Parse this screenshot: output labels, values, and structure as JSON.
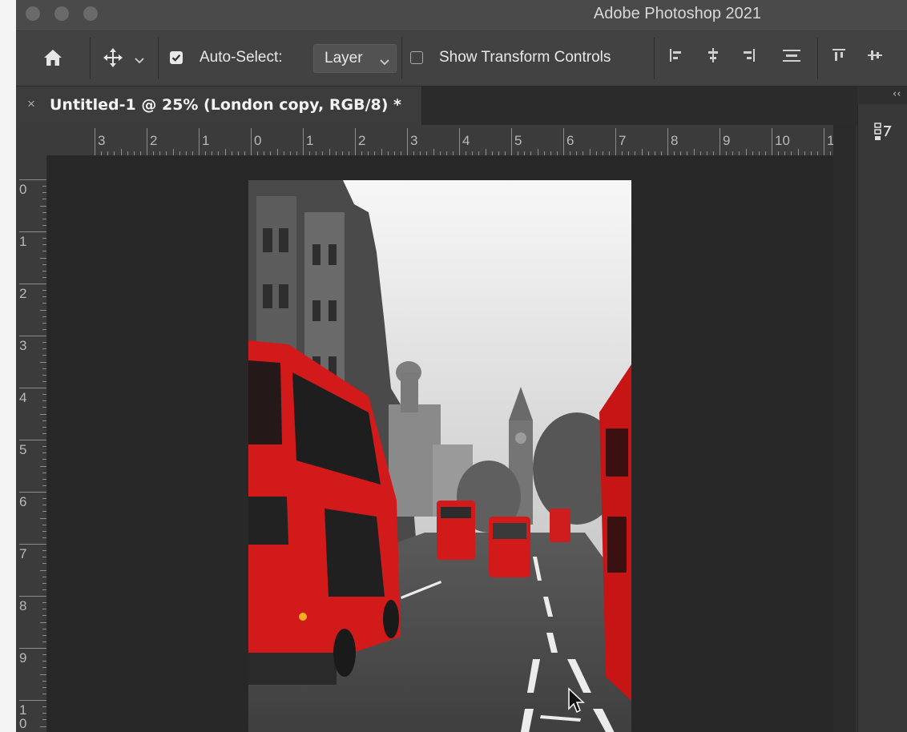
{
  "window": {
    "title": "Adobe Photoshop 2021"
  },
  "options_bar": {
    "auto_select_label": "Auto-Select:",
    "auto_select_checked": true,
    "layer_select_value": "Layer",
    "show_transform_label": "Show Transform Controls",
    "show_transform_checked": false,
    "icons": [
      "home-icon",
      "move-tool-icon",
      "chevron-down-icon",
      "align-left-edges-icon",
      "align-horizontal-centers-icon",
      "align-right-edges-icon",
      "distribute-vertical-icon",
      "align-top-edges-icon",
      "align-vertical-centers-icon"
    ]
  },
  "document_tab": {
    "close_symbol": "×",
    "label": "Untitled-1 @ 25% (London copy, RGB/8) *"
  },
  "ruler_horizontal": {
    "labels": [
      "3",
      "2",
      "1",
      "0",
      "1",
      "2",
      "3",
      "4",
      "5",
      "6",
      "7",
      "8",
      "9",
      "10",
      "1"
    ]
  },
  "ruler_vertical": {
    "labels": [
      "0",
      "1",
      "2",
      "3",
      "4",
      "5",
      "6",
      "7",
      "8",
      "9",
      "1"
    ],
    "last_sub_label": "0"
  },
  "panel": {
    "icons": [
      "history-icon"
    ]
  },
  "colors": {
    "bus_red": "#d21a1a",
    "app_bg": "#323232",
    "canvas_bg": "#282828"
  }
}
